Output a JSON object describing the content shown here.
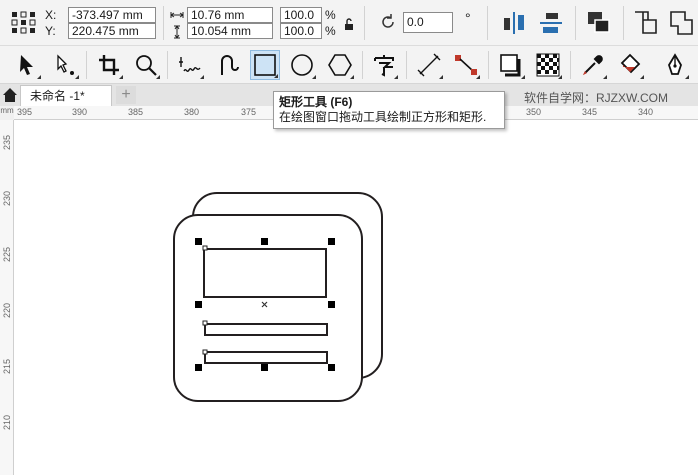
{
  "position": {
    "icon": "object-origin-icon",
    "x_label": "X:",
    "y_label": "Y:",
    "x_value": "-373.497 mm",
    "y_value": "220.475 mm"
  },
  "size": {
    "width_value": "10.76 mm",
    "height_value": "10.054 mm",
    "scale_x": "100.0",
    "scale_y": "100.0",
    "pct": "%"
  },
  "rotation": {
    "value": "0.0",
    "unit": "°"
  },
  "property_icons": [
    "lock-ratio-icon",
    "rotate-icon",
    "mirror-horizontal-icon",
    "mirror-vertical-icon",
    "arrange-order-icon",
    "combine-icon"
  ],
  "tools": [
    {
      "name": "pick-tool",
      "active": false
    },
    {
      "name": "shape-tool",
      "active": false
    },
    {
      "name": "crop-tool",
      "active": false
    },
    {
      "name": "zoom-tool",
      "active": false
    },
    {
      "name": "freehand-tool",
      "active": false
    },
    {
      "name": "artistic-media-tool",
      "active": false
    },
    {
      "name": "rectangle-tool",
      "active": true
    },
    {
      "name": "ellipse-tool",
      "active": false
    },
    {
      "name": "polygon-tool",
      "active": false
    },
    {
      "name": "text-tool",
      "active": false
    },
    {
      "name": "parallel-dimension-tool",
      "active": false
    },
    {
      "name": "connector-tool",
      "active": false
    },
    {
      "name": "drop-shadow-tool",
      "active": false
    },
    {
      "name": "transparency-tool",
      "active": false
    },
    {
      "name": "eyedropper-tool",
      "active": false
    },
    {
      "name": "interactive-fill-tool",
      "active": false
    },
    {
      "name": "smart-fill-tool",
      "active": false
    }
  ],
  "tabs": {
    "document": "未命名 -1*",
    "add": "+"
  },
  "watermark": "软件自学网：RJZXW.COM",
  "tooltip": {
    "title": "矩形工具 (F6)",
    "description": "在绘图窗口拖动工具绘制正方形和矩形."
  },
  "ruler": {
    "corner": "mm",
    "top_ticks": [
      "395",
      "390",
      "385",
      "380",
      "375",
      "350",
      "345",
      "340"
    ],
    "left_ticks": [
      "235",
      "230",
      "225",
      "220",
      "215",
      "210"
    ]
  },
  "colors": {
    "active_tool_bg": "#cde3f5",
    "stroke": "#231f20",
    "handle": "#000000"
  }
}
